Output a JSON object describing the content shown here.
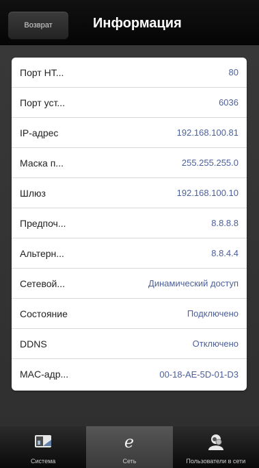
{
  "header": {
    "back_label": "Возврат",
    "title": "Информация"
  },
  "rows": [
    {
      "label": "Порт НТ...",
      "value": "80"
    },
    {
      "label": "Порт уст...",
      "value": "6036"
    },
    {
      "label": "IP-адрес",
      "value": "192.168.100.81"
    },
    {
      "label": "Маска п...",
      "value": "255.255.255.0"
    },
    {
      "label": "Шлюз",
      "value": "192.168.100.10"
    },
    {
      "label": "Предпоч...",
      "value": "8.8.8.8"
    },
    {
      "label": "Альтерн...",
      "value": "8.8.4.4"
    },
    {
      "label": "Сетевой...",
      "value": "Динамический доступ"
    },
    {
      "label": "Состояние",
      "value": "Подключено"
    },
    {
      "label": "DDNS",
      "value": "Отключено"
    },
    {
      "label": "MAC-адр...",
      "value": "00-18-AE-5D-01-D3"
    }
  ],
  "tabs": [
    {
      "label": "Система",
      "icon": "system-icon",
      "active": false
    },
    {
      "label": "Сеть",
      "icon": "network-icon",
      "active": true
    },
    {
      "label": "Пользователи в сети",
      "icon": "online-users-icon",
      "active": false
    }
  ],
  "colors": {
    "value_text": "#4b5f9c",
    "header_bg": "#0a0a0a",
    "content_bg": "#353535"
  }
}
